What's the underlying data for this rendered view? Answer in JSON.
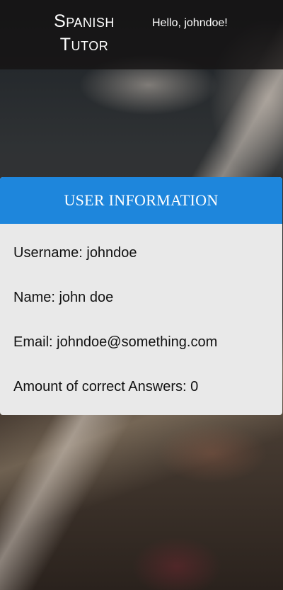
{
  "header": {
    "brand_line1": "Spanish",
    "brand_line2": "Tutor",
    "greeting": "Hello, johndoe!"
  },
  "card": {
    "title": "USER INFORMATION",
    "rows": [
      "Username: johndoe",
      "Name: john doe",
      "Email: johndoe@something.com",
      "Amount of correct Answers: 0"
    ]
  },
  "colors": {
    "accent": "#1e86dc",
    "card_bg": "#e9e9e9"
  }
}
